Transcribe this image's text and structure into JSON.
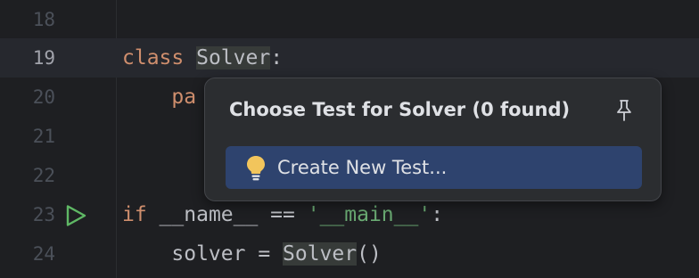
{
  "editor": {
    "lines": [
      {
        "number": "18",
        "code": ""
      },
      {
        "number": "19",
        "keyword": "class",
        "name": "Solver",
        "punct": ":"
      },
      {
        "number": "20",
        "code": "    pa"
      },
      {
        "number": "21",
        "code": ""
      },
      {
        "number": "22",
        "code": ""
      },
      {
        "number": "23",
        "keyword": "if",
        "middle": " __name__ == ",
        "string": "'__main__'",
        "punct": ":"
      },
      {
        "number": "24",
        "prefix": "    solver = ",
        "name": "Solver",
        "suffix": "()"
      }
    ]
  },
  "popup": {
    "title": "Choose Test for Solver (0 found)",
    "item_label": "Create New Test...",
    "icons": {
      "pin": "pin-icon",
      "bulb": "lightbulb-icon",
      "run": "run-icon"
    }
  },
  "colors": {
    "background": "#1e1f22",
    "current_line": "#26282e",
    "keyword": "#cf8e6d",
    "string": "#6aab73",
    "text": "#bcbec4",
    "popup_bg": "#2b2d30",
    "selected_item": "#2e436e",
    "run_green": "#5fb865",
    "bulb_yellow": "#f2c55c"
  }
}
